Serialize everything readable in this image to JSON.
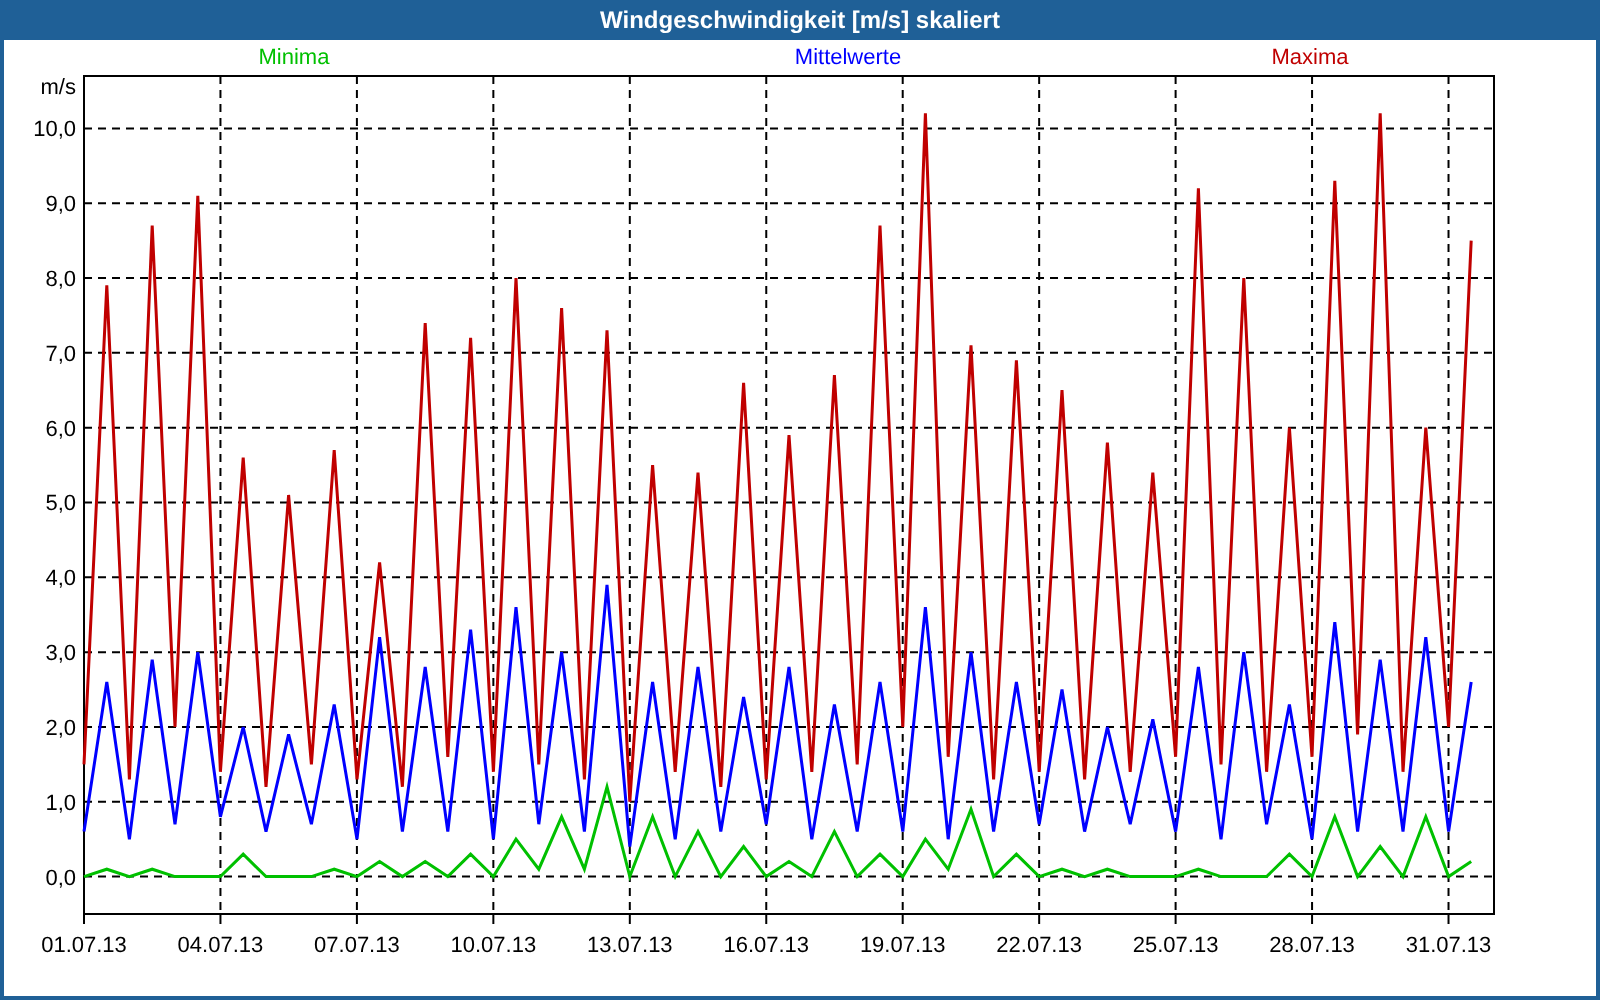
{
  "window": {
    "title": "Windgeschwindigkeit [m/s] skaliert"
  },
  "chart": {
    "chart_data": {
      "type": "line",
      "grid": true,
      "ylabel": "m/s",
      "ylim": [
        -0.5,
        10.7
      ],
      "yticks": [
        {
          "value": 0,
          "label": "0,0"
        },
        {
          "value": 1,
          "label": "1,0"
        },
        {
          "value": 2,
          "label": "2,0"
        },
        {
          "value": 3,
          "label": "3,0"
        },
        {
          "value": 4,
          "label": "4,0"
        },
        {
          "value": 5,
          "label": "5,0"
        },
        {
          "value": 6,
          "label": "6,0"
        },
        {
          "value": 7,
          "label": "7,0"
        },
        {
          "value": 8,
          "label": "8,0"
        },
        {
          "value": 9,
          "label": "9,0"
        },
        {
          "value": 10,
          "label": "10,0"
        }
      ],
      "categories": [
        "01.07.13",
        null,
        null,
        null,
        null,
        null,
        "04.07.13",
        null,
        null,
        null,
        null,
        null,
        "07.07.13",
        null,
        null,
        null,
        null,
        null,
        "10.07.13",
        null,
        null,
        null,
        null,
        null,
        "13.07.13",
        null,
        null,
        null,
        null,
        null,
        "16.07.13",
        null,
        null,
        null,
        null,
        null,
        "19.07.13",
        null,
        null,
        null,
        null,
        null,
        "22.07.13",
        null,
        null,
        null,
        null,
        null,
        "25.07.13",
        null,
        null,
        null,
        null,
        null,
        "28.07.13",
        null,
        null,
        null,
        null,
        null,
        "31.07.13",
        null
      ],
      "series": [
        {
          "name": "Minima",
          "color": "#00c000",
          "values": [
            0.0,
            0.1,
            0.0,
            0.1,
            0.0,
            0.0,
            0.0,
            0.3,
            0.0,
            0.0,
            0.0,
            0.1,
            0.0,
            0.2,
            0.0,
            0.2,
            0.0,
            0.3,
            0.0,
            0.5,
            0.1,
            0.8,
            0.1,
            1.2,
            0.0,
            0.8,
            0.0,
            0.6,
            0.0,
            0.4,
            0.0,
            0.2,
            0.0,
            0.6,
            0.0,
            0.3,
            0.0,
            0.5,
            0.1,
            0.9,
            0.0,
            0.3,
            0.0,
            0.1,
            0.0,
            0.1,
            0.0,
            0.0,
            0.0,
            0.1,
            0.0,
            0.0,
            0.0,
            0.3,
            0.0,
            0.8,
            0.0,
            0.4,
            0.0,
            0.8,
            0.0,
            0.2
          ]
        },
        {
          "name": "Mittelwerte",
          "color": "#0000ff",
          "values": [
            0.6,
            2.6,
            0.5,
            2.9,
            0.7,
            3.0,
            0.8,
            2.0,
            0.6,
            1.9,
            0.7,
            2.3,
            0.5,
            3.2,
            0.6,
            2.8,
            0.6,
            3.3,
            0.5,
            3.6,
            0.7,
            3.0,
            0.6,
            3.9,
            0.4,
            2.6,
            0.5,
            2.8,
            0.6,
            2.4,
            0.7,
            2.8,
            0.5,
            2.3,
            0.6,
            2.6,
            0.6,
            3.6,
            0.5,
            3.0,
            0.6,
            2.6,
            0.7,
            2.5,
            0.6,
            2.0,
            0.7,
            2.1,
            0.6,
            2.8,
            0.5,
            3.0,
            0.7,
            2.3,
            0.5,
            3.4,
            0.6,
            2.9,
            0.6,
            3.2,
            0.6,
            2.6
          ]
        },
        {
          "name": "Maxima",
          "color": "#c00000",
          "values": [
            1.5,
            7.9,
            1.3,
            8.7,
            2.0,
            9.1,
            1.4,
            5.6,
            1.2,
            5.1,
            1.5,
            5.7,
            1.3,
            4.2,
            1.2,
            7.4,
            1.6,
            7.2,
            1.4,
            8.0,
            1.5,
            7.6,
            1.3,
            7.3,
            1.0,
            5.5,
            1.4,
            5.4,
            1.2,
            6.6,
            1.3,
            5.9,
            1.4,
            6.7,
            1.5,
            8.7,
            2.0,
            10.2,
            1.6,
            7.1,
            1.3,
            6.9,
            1.4,
            6.5,
            1.3,
            5.8,
            1.4,
            5.4,
            1.6,
            9.2,
            1.5,
            8.0,
            1.4,
            6.0,
            1.6,
            9.3,
            1.9,
            10.2,
            1.4,
            6.0,
            2.0,
            8.5
          ]
        }
      ]
    }
  }
}
